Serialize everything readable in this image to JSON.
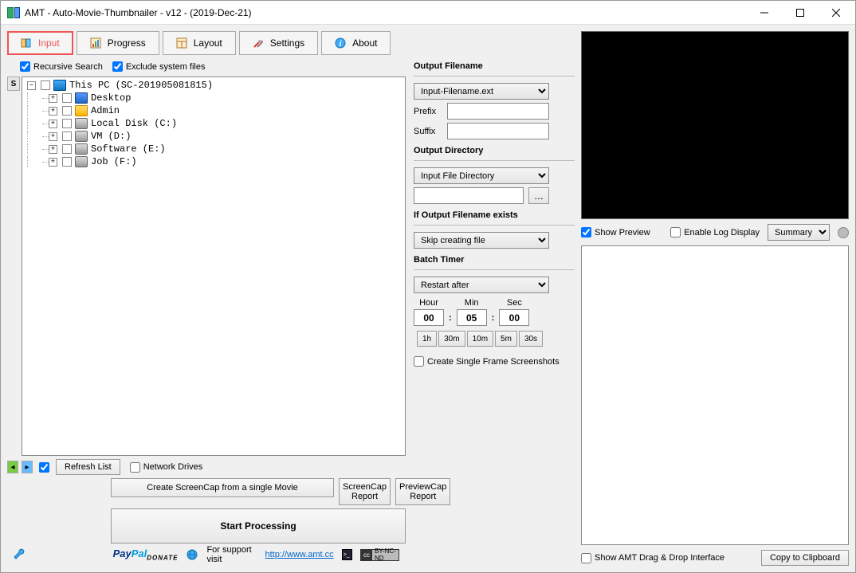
{
  "window": {
    "title": "AMT - Auto-Movie-Thumbnailer - v12 - (2019-Dec-21)"
  },
  "tabs": {
    "input": "Input",
    "progress": "Progress",
    "layout": "Layout",
    "settings": "Settings",
    "about": "About"
  },
  "checks": {
    "recursive": "Recursive Search",
    "exclude": "Exclude system files",
    "networkDrives": "Network Drives"
  },
  "tree": {
    "root": "This PC (SC-201905081815)",
    "n1": "Desktop",
    "n2": "Admin",
    "n3": "Local Disk (C:)",
    "n4": "VM (D:)",
    "n5": "Software (E:)",
    "n6": "Job (F:)"
  },
  "buttons": {
    "refresh": "Refresh List",
    "singleMovie": "Create ScreenCap from a single Movie",
    "screencapReport1": "ScreenCap",
    "screencapReport2": "Report",
    "previewcapReport1": "PreviewCap",
    "previewcapReport2": "Report",
    "start": "Start Processing",
    "copy": "Copy to Clipboard",
    "browse": "..."
  },
  "output": {
    "filenameLabel": "Output Filename",
    "filenameOption": "Input-Filename.ext",
    "prefixLabel": "Prefix",
    "prefixValue": "",
    "suffixLabel": "Suffix",
    "suffixValue": "",
    "dirLabel": "Output Directory",
    "dirOption": "Input File Directory",
    "dirPath": "",
    "existsLabel": "If Output Filename exists",
    "existsOption": "Skip creating file"
  },
  "timer": {
    "label": "Batch Timer",
    "restartOption": "Restart after",
    "hourLabel": "Hour",
    "minLabel": "Min",
    "secLabel": "Sec",
    "hour": "00",
    "min": "05",
    "sec": "00",
    "p1": "1h",
    "p2": "30m",
    "p3": "10m",
    "p4": "5m",
    "p5": "30s"
  },
  "singleFrame": "Create Single Frame Screenshots",
  "preview": {
    "show": "Show Preview",
    "enableLog": "Enable Log Display",
    "summary": "Summary",
    "showDragDrop": "Show AMT Drag & Drop Interface"
  },
  "footer": {
    "support": "For support visit",
    "url": "http://www.amt.cc",
    "cc1": "cc",
    "cc2": "BY-NC-ND"
  },
  "sLabel": "S"
}
